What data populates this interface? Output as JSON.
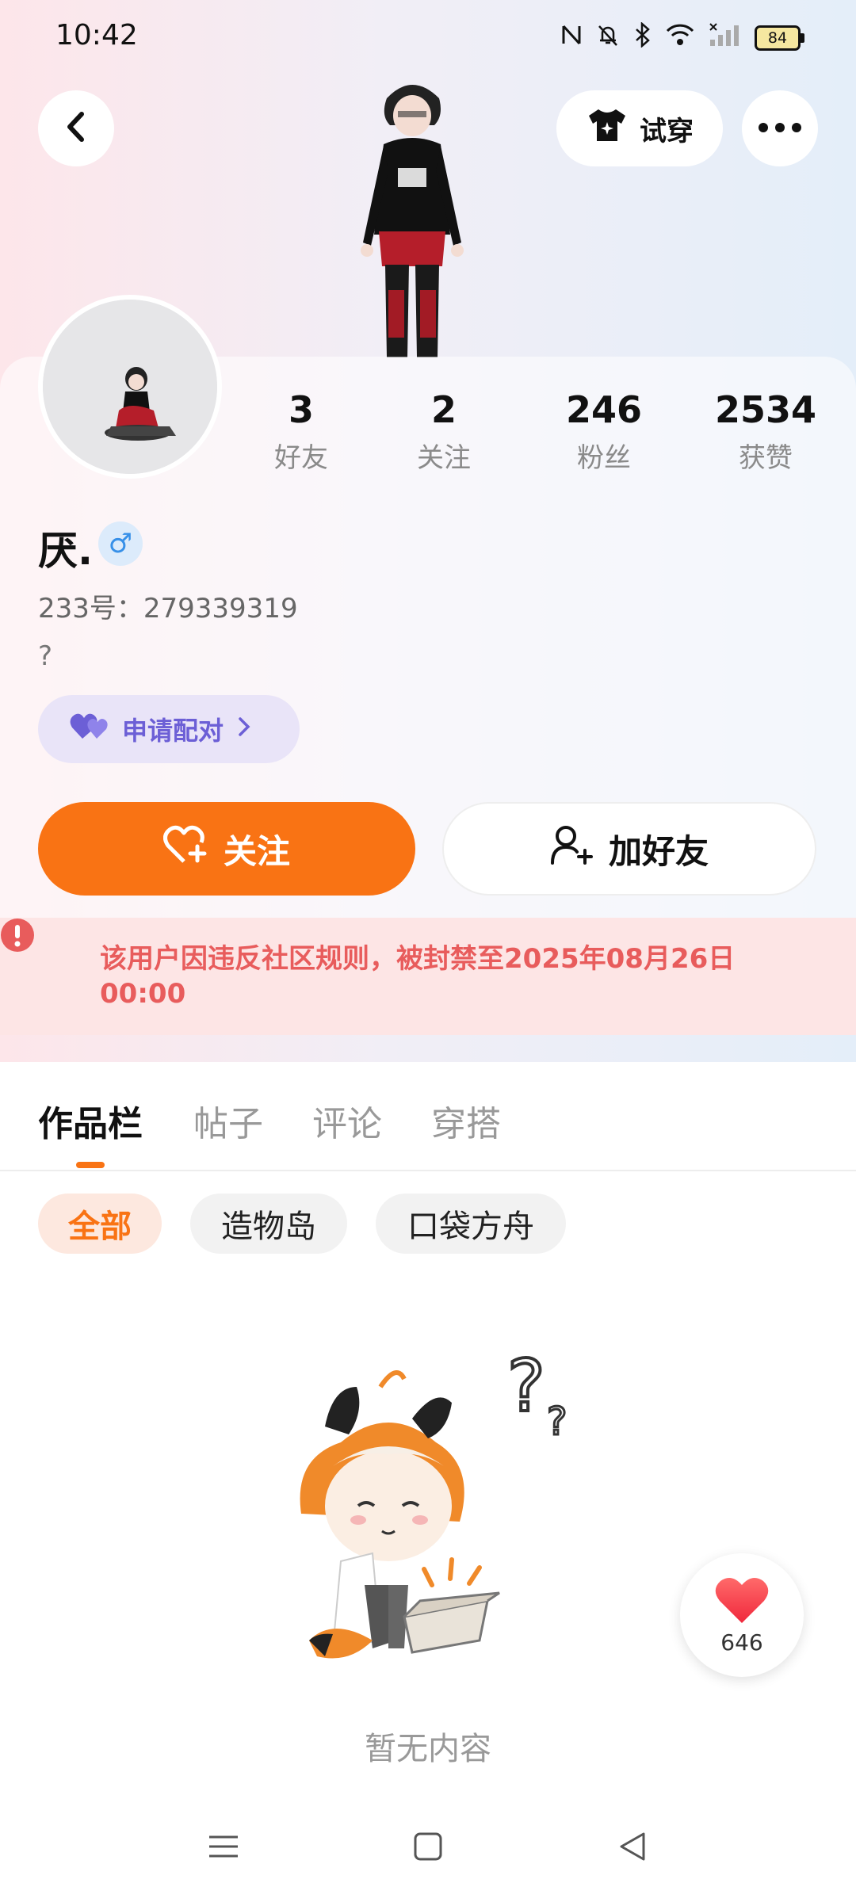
{
  "status_bar": {
    "time": "10:42",
    "battery": "84"
  },
  "header": {
    "try_on_label": "试穿"
  },
  "profile": {
    "stats": [
      {
        "value": "3",
        "label": "好友"
      },
      {
        "value": "2",
        "label": "关注"
      },
      {
        "value": "246",
        "label": "粉丝"
      },
      {
        "value": "2534",
        "label": "获赞"
      }
    ],
    "name": "厌.",
    "gender_symbol": "♂",
    "uid_text": "233号：279339319",
    "bio": "?",
    "pair_label": "申请配对"
  },
  "actions": {
    "follow_label": "关注",
    "add_friend_label": "加好友"
  },
  "banner": {
    "text": "该用户因违反社区规则，被封禁至2025年08月26日 00:00"
  },
  "tabs": [
    "作品栏",
    "帖子",
    "评论",
    "穿搭"
  ],
  "filters": [
    "全部",
    "造物岛",
    "口袋方舟"
  ],
  "empty": {
    "text": "暂无内容"
  },
  "like_fab": {
    "count": "646"
  },
  "colors": {
    "accent": "#f97314",
    "banner_text": "#e85c5c",
    "pair_purple": "#6c5fd6"
  }
}
